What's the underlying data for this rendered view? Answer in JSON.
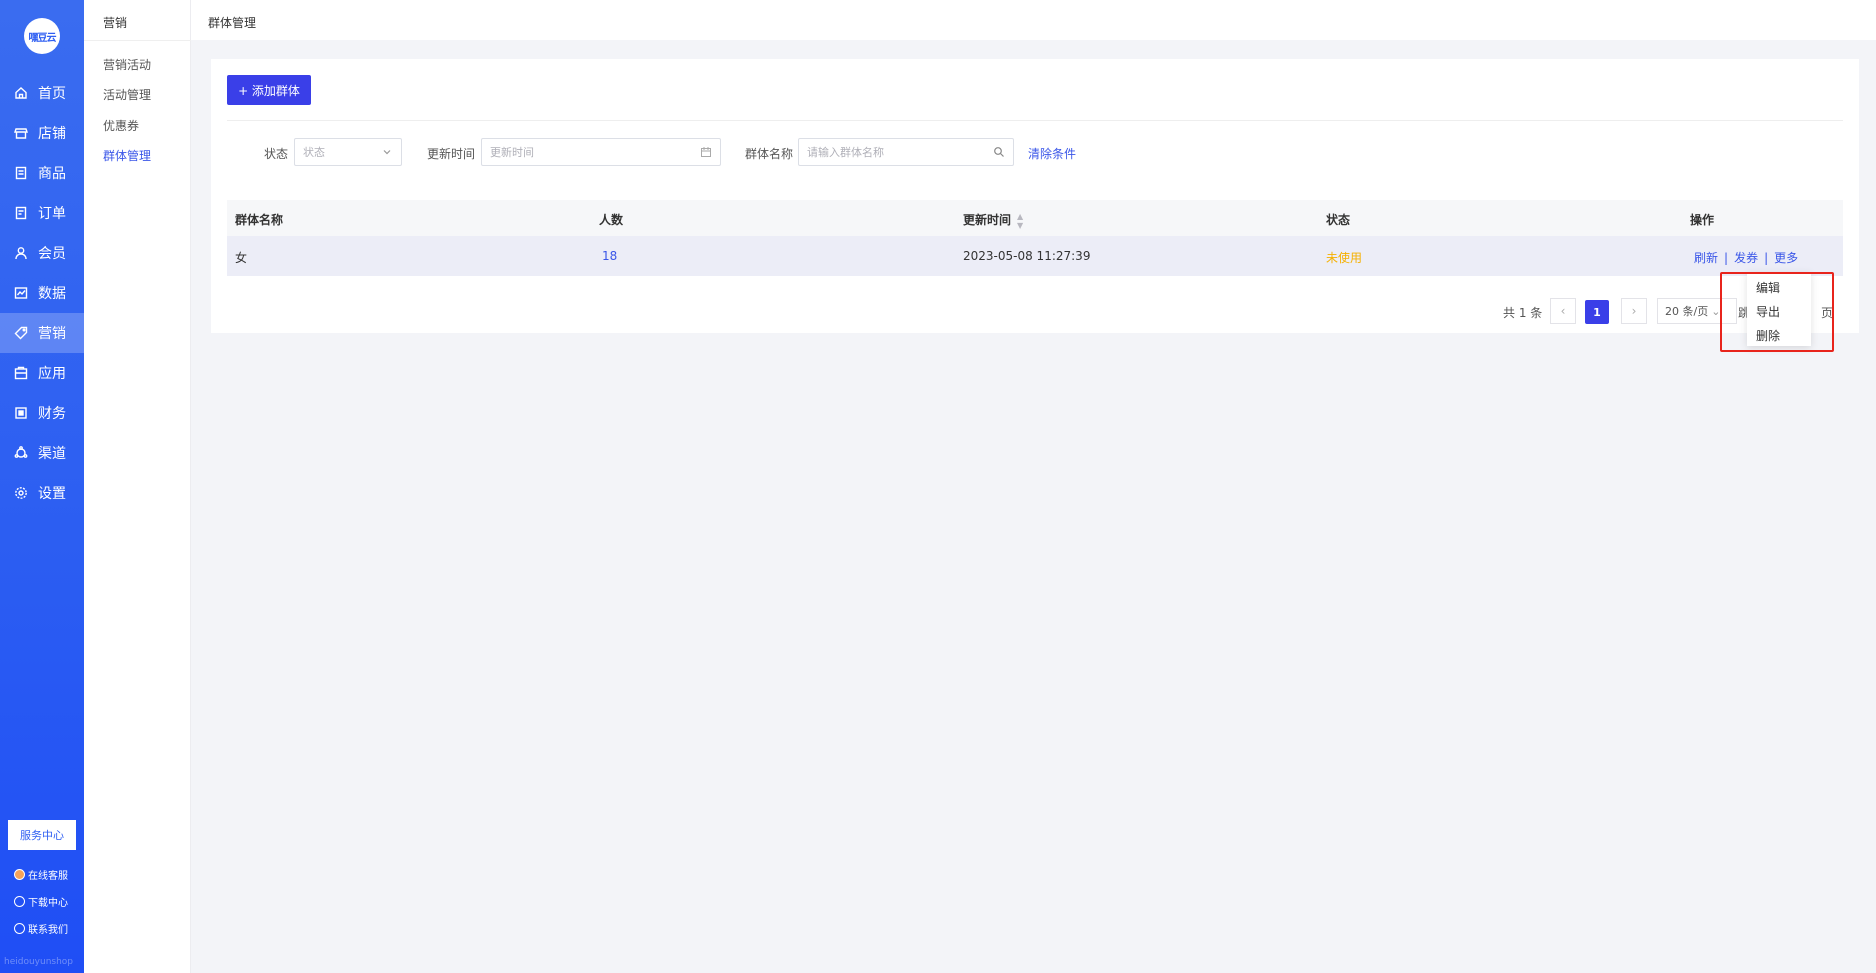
{
  "brand": {
    "logo_text": "嘿豆云"
  },
  "main_nav": [
    {
      "label": "首页",
      "icon": "home-icon"
    },
    {
      "label": "店铺",
      "icon": "store-icon"
    },
    {
      "label": "商品",
      "icon": "goods-icon"
    },
    {
      "label": "订单",
      "icon": "order-icon"
    },
    {
      "label": "会员",
      "icon": "member-icon"
    },
    {
      "label": "数据",
      "icon": "data-icon"
    },
    {
      "label": "营销",
      "icon": "tag-icon",
      "active": true
    },
    {
      "label": "应用",
      "icon": "app-icon"
    },
    {
      "label": "财务",
      "icon": "finance-icon"
    },
    {
      "label": "渠道",
      "icon": "channel-icon"
    },
    {
      "label": "设置",
      "icon": "gear-icon"
    }
  ],
  "nav_footer": {
    "service_center": "服务中心",
    "online_service": "在线客服",
    "download_center": "下载中心",
    "contact_us": "联系我们",
    "watermark": "heidouyunshop"
  },
  "sub_nav": {
    "title": "营销",
    "items": [
      "营销活动",
      "活动管理",
      "优惠券",
      "群体管理"
    ],
    "active_index": 3
  },
  "breadcrumb": "群体管理",
  "toolbar": {
    "add_label": "+ 添加群体"
  },
  "filters": {
    "status_label": "状态",
    "status_placeholder": "状态",
    "time_label": "更新时间",
    "time_placeholder": "更新时间",
    "name_label": "群体名称",
    "name_placeholder": "请输入群体名称",
    "clear_label": "清除条件"
  },
  "table": {
    "columns": [
      "群体名称",
      "人数",
      "更新时间",
      "状态",
      "操作"
    ],
    "rows": [
      {
        "name": "女",
        "count": "18",
        "updated": "2023-05-08 11:27:39",
        "status": "未使用",
        "actions": [
          "刷新",
          "发券",
          "更多"
        ]
      }
    ]
  },
  "pagination": {
    "total": "共 1 条",
    "current": "1",
    "page_size": "20 条/页",
    "jump_prefix": "跳",
    "jump_suffix": "页"
  },
  "more_menu": [
    "编辑",
    "导出",
    "删除"
  ],
  "colors": {
    "primary": "#3a3fe8",
    "link": "#3a56e8",
    "warn": "#f5b000",
    "highlight": "#e8241c"
  }
}
